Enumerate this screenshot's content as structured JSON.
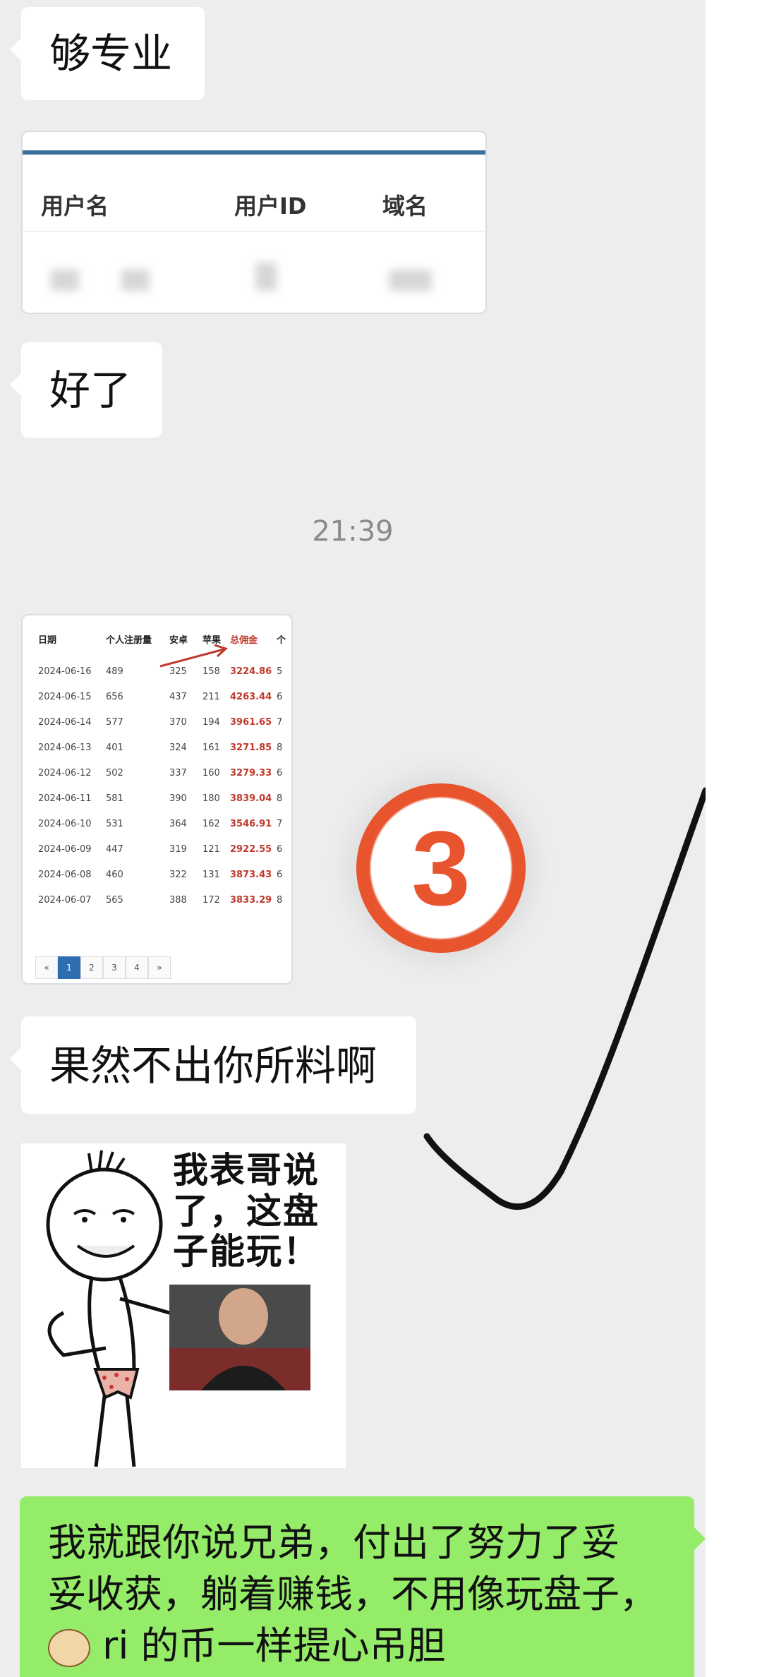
{
  "messages": {
    "m1": "够专业",
    "m2": "好了",
    "m3": "果然不出你所料啊",
    "m4_line1": "我就跟你说兄弟，付出了努力了妥",
    "m4_line2": "妥收获，躺着赚钱，不用像玩盘子，",
    "m4_line3": "ri 的币一样提心吊胆"
  },
  "timestamp": "21:39",
  "user_table": {
    "headers": [
      "用户名",
      "用户ID",
      "域名"
    ]
  },
  "stats_table": {
    "headers": [
      "日期",
      "个人注册量",
      "安卓",
      "苹果",
      "总佣金",
      "个"
    ],
    "rows": [
      [
        "2024-06-16",
        "489",
        "325",
        "158",
        "3224.86",
        "5"
      ],
      [
        "2024-06-15",
        "656",
        "437",
        "211",
        "4263.44",
        "6"
      ],
      [
        "2024-06-14",
        "577",
        "370",
        "194",
        "3961.65",
        "7"
      ],
      [
        "2024-06-13",
        "401",
        "324",
        "161",
        "3271.85",
        "8"
      ],
      [
        "2024-06-12",
        "502",
        "337",
        "160",
        "3279.33",
        "6"
      ],
      [
        "2024-06-11",
        "581",
        "390",
        "180",
        "3839.04",
        "8"
      ],
      [
        "2024-06-10",
        "531",
        "364",
        "162",
        "3546.91",
        "7"
      ],
      [
        "2024-06-09",
        "447",
        "319",
        "121",
        "2922.55",
        "6"
      ],
      [
        "2024-06-08",
        "460",
        "322",
        "131",
        "3873.43",
        "6"
      ],
      [
        "2024-06-07",
        "565",
        "388",
        "172",
        "3833.29",
        "8"
      ]
    ],
    "pager": [
      "«",
      "1",
      "2",
      "3",
      "4",
      "»"
    ]
  },
  "badge_number": "3",
  "meme": {
    "line1": "我表哥说",
    "line2": "了，这盘",
    "line3": "子能玩！"
  },
  "colors": {
    "chat_bg": "#ededed",
    "my_bubble": "#95ec69",
    "badge": "#e8542e",
    "stats_red": "#c0392b"
  }
}
